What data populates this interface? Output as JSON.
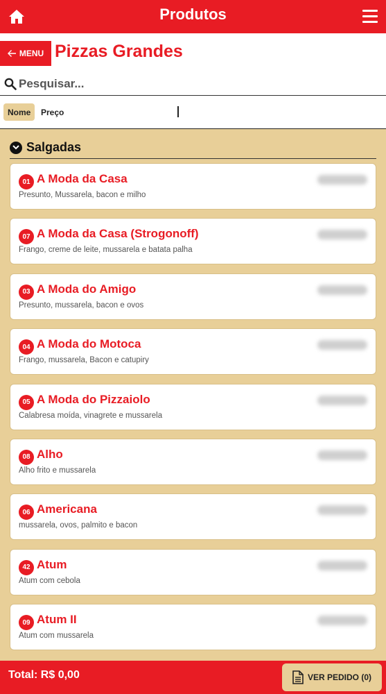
{
  "topbar": {
    "title": "Produtos",
    "home_icon": "home-icon",
    "menu_icon": "hamburger-menu-icon"
  },
  "header": {
    "menu_label": "MENU",
    "page_title": "Pizzas Grandes",
    "search_placeholder": "Pesquisar...",
    "sort_active": "Nome",
    "sort_other": "Preço"
  },
  "section": {
    "label": "Salgadas"
  },
  "products": [
    {
      "num": "01",
      "name": "A Moda da Casa",
      "desc": "Presunto, Mussarela, bacon e milho"
    },
    {
      "num": "07",
      "name": "A Moda da Casa (Strogonoff)",
      "desc": "Frango, creme de leite, mussarela e batata palha"
    },
    {
      "num": "03",
      "name": "A Moda do Amigo",
      "desc": "Presunto, mussarela, bacon e ovos"
    },
    {
      "num": "04",
      "name": "A Moda do Motoca",
      "desc": "Frango, mussarela, Bacon e catupiry"
    },
    {
      "num": "05",
      "name": "A Moda do Pizzaiolo",
      "desc": "Calabresa moída, vinagrete e mussarela"
    },
    {
      "num": "08",
      "name": "Alho",
      "desc": "Alho frito e mussarela"
    },
    {
      "num": "06",
      "name": "Americana",
      "desc": "mussarela, ovos, palmito e bacon"
    },
    {
      "num": "42",
      "name": "Atum",
      "desc": "Atum com cebola"
    },
    {
      "num": "09",
      "name": "Atum II",
      "desc": "Atum com mussarela"
    }
  ],
  "footer": {
    "total": "Total: R$ 0,00",
    "order_label": "VER PEDIDO (0)"
  },
  "colors": {
    "brand_red": "#e81c24",
    "beige": "#e8cf98"
  }
}
